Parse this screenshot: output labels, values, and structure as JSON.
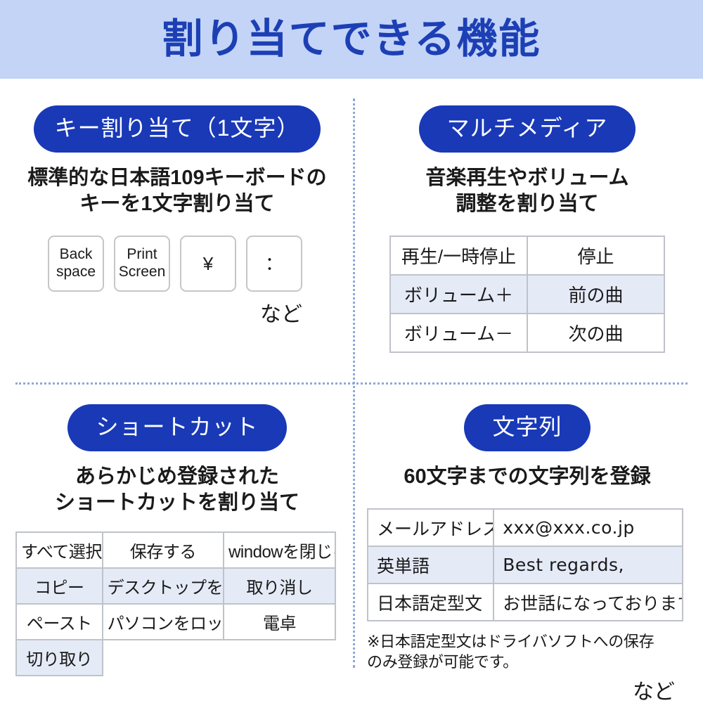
{
  "header": {
    "title": "割り当てできる機能",
    "band_color": "#c3d4f7",
    "title_color": "#1d3fb5"
  },
  "theme": {
    "pill_color": "#1939b7",
    "pill_text_color": "#ffffff",
    "table_border_color": "#bfc3c9",
    "table_tint_color": "#e5eaf7",
    "divider_color": "#8fa7da",
    "text_color": "#1a1a1a"
  },
  "quadrants": {
    "key_assign": {
      "pill_label": "キー割り当て（1文字）",
      "description_line1": "標準的な日本語109キーボードの",
      "description_line2": "キーを1文字割り当て",
      "keycaps": [
        {
          "line1": "Back",
          "line2": "space"
        },
        {
          "line1": "Print",
          "line2": "Screen"
        },
        {
          "line1": "¥",
          "line2": ""
        },
        {
          "line1": "：",
          "line2": ""
        }
      ],
      "etc_label": "など"
    },
    "multimedia": {
      "pill_label": "マルチメディア",
      "description_line1": "音楽再生やボリューム",
      "description_line2": "調整を割り当て",
      "table": {
        "rows": [
          {
            "tint": false,
            "cells": [
              "再生/一時停止",
              "停止"
            ]
          },
          {
            "tint": true,
            "cells": [
              "ボリューム＋",
              "前の曲"
            ]
          },
          {
            "tint": false,
            "cells": [
              "ボリューム－",
              "次の曲"
            ]
          }
        ]
      }
    },
    "shortcut": {
      "pill_label": "ショートカット",
      "description_line1": "あらかじめ登録された",
      "description_line2": "ショートカットを割り当て",
      "table": {
        "rows": [
          {
            "tint": false,
            "cells": [
              "すべて選択",
              "保存する",
              "windowを閉じる"
            ]
          },
          {
            "tint": true,
            "cells": [
              "コピー",
              "デスクトップを表示",
              "取り消し"
            ]
          },
          {
            "tint": false,
            "cells": [
              "ペースト",
              "パソコンをロック",
              "電卓"
            ]
          },
          {
            "tint": true,
            "cells": [
              "切り取り",
              "",
              ""
            ]
          }
        ]
      }
    },
    "text_string": {
      "pill_label": "文字列",
      "description_line1": "60文字までの文字列を登録",
      "table": {
        "rows": [
          {
            "tint": false,
            "label": "メールアドレス",
            "value": "xxx@xxx.co.jp"
          },
          {
            "tint": true,
            "label": "英単語",
            "value": "Best regards,"
          },
          {
            "tint": false,
            "label": "日本語定型文",
            "value": "お世話になっております。"
          }
        ]
      },
      "footnote_line1": "※日本語定型文はドライバソフトへの保存",
      "footnote_line2": "のみ登録が可能です。",
      "etc_label": "など"
    }
  }
}
